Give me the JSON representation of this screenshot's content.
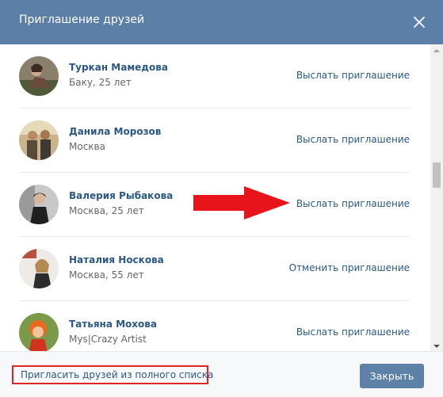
{
  "dialog": {
    "title": "Приглашение друзей",
    "close_icon": "close-icon"
  },
  "friends": [
    {
      "name": "Туркан Мамедова",
      "info": "Баку, 25 лет",
      "action": "Выслать приглашение"
    },
    {
      "name": "Данила Морозов",
      "info": "Москва",
      "action": "Выслать приглашение"
    },
    {
      "name": "Валерия Рыбакова",
      "info": "Москва, 25 лет",
      "action": "Выслать приглашение"
    },
    {
      "name": "Наталия Носкова",
      "info": "Москва, 55 лет",
      "action": "Отменить приглашение"
    },
    {
      "name": "Татьяна Мохова",
      "info": "Mys|Crazy Artist",
      "action": "Выслать приглашение"
    }
  ],
  "footer": {
    "invite_from_full_list": "Пригласить друзей из полного списка",
    "close_label": "Закрыть"
  },
  "colors": {
    "header_bg": "#5b7fa6",
    "link": "#2a5885",
    "highlight_border": "#e02424",
    "arrow": "#e8141b",
    "button_bg": "#5e81a8"
  }
}
